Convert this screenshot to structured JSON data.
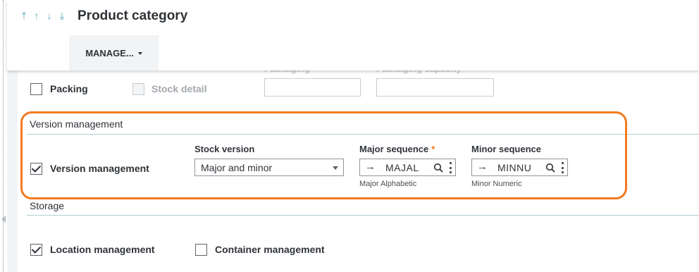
{
  "header": {
    "nav_icons": [
      "first-icon",
      "up-icon",
      "down-icon",
      "last-icon"
    ],
    "title": "Product category",
    "manage_label": "MANAGE..."
  },
  "top_row": {
    "packing_label": "Packing",
    "stock_detail_label": "Stock detail",
    "packaging_label": "Packaging",
    "packaging_capacity_label": "Packaging capacity"
  },
  "version_section": {
    "title": "Version management",
    "checkbox_label": "Version management",
    "stock_version_label": "Stock version",
    "stock_version_value": "Major and minor",
    "major_label": "Major sequence",
    "major_required": "*",
    "major_value": "MAJAL",
    "major_desc": "Major Alphabetic",
    "minor_label": "Minor sequence",
    "minor_value": "MINNU",
    "minor_desc": "Minor Numeric"
  },
  "storage_section": {
    "title": "Storage",
    "location_label": "Location management",
    "container_label": "Container management"
  },
  "colors": {
    "highlight": "#f47b20",
    "accent": "#58a6b9"
  }
}
